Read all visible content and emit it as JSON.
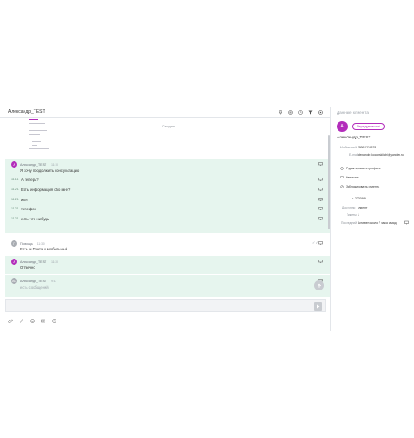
{
  "chat": {
    "title": "Александр_TEST",
    "day_label": "Сегодня",
    "header_icons": [
      "pin-icon",
      "hashtag-icon",
      "timer-icon",
      "filter-icon",
      "settings-icon"
    ],
    "messages": [
      {
        "author": "Александр_TEST",
        "avatar": "А",
        "time": "11:10",
        "text": "Я хочу продолжить консультацию"
      },
      {
        "time": "11:11",
        "text": "А теперь?"
      },
      {
        "time": "11:21",
        "text": "Есть информация обо мне?"
      },
      {
        "time": "11:21",
        "text": "имя"
      },
      {
        "time": "11:21",
        "text": "телефон"
      },
      {
        "time": "11:21",
        "text": "есть что-нибудь"
      },
      {
        "author": "Помощь",
        "avatar": "П",
        "time": "11:30",
        "text": "Есть и Почта и мобильный"
      },
      {
        "author": "Александр_TEST",
        "avatar": "А",
        "time": "11:30",
        "text": "Отлично"
      },
      {
        "author": "Александр_TEST",
        "avatar": "АС",
        "time": "9:11",
        "text": "есть сообщений"
      }
    ],
    "composer_placeholder": "",
    "toolbar_icons": [
      "attach-icon",
      "slash-icon",
      "emoji-icon",
      "template-icon",
      "star-icon"
    ]
  },
  "client": {
    "header": "Данные клиента",
    "avatar": "А",
    "badge": "Передумавший",
    "name": "Александр_TEST",
    "phone_label": "Мобильный",
    "phone": "79991234578",
    "email_label": "E-mail",
    "email": "alexander.koconskiichi@yandex.ru",
    "actions": [
      "Редактировать профиль",
      "Написать",
      "Заблокировать клиента"
    ],
    "id": "223099",
    "status_label": "Доступно",
    "status": "клиент",
    "tickets_label": "Тикеты",
    "tickets": "1",
    "source_label": "Последний",
    "source": "Активен около 7 часа назад"
  }
}
